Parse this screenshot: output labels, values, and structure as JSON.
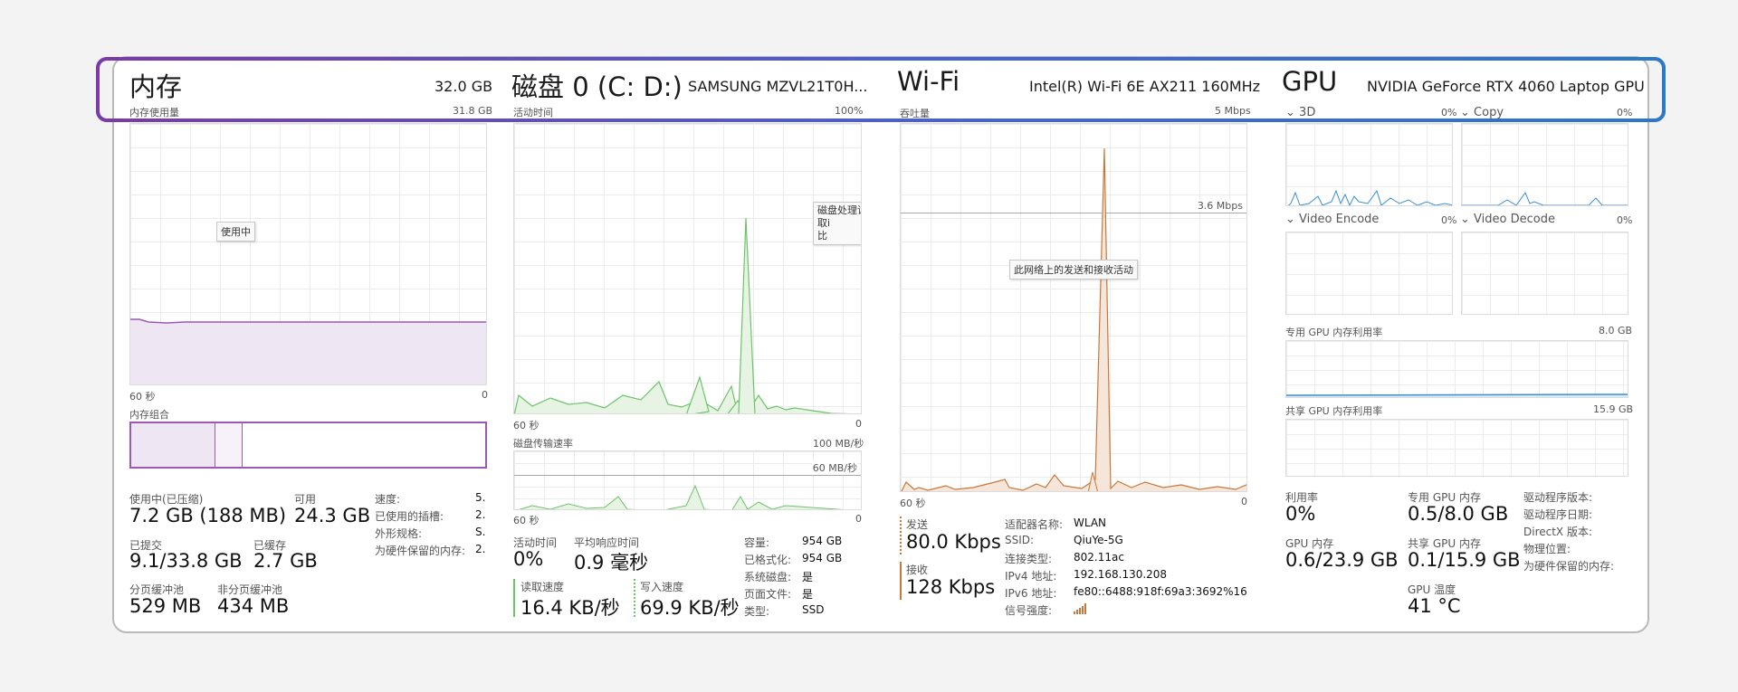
{
  "memory": {
    "title": "内存",
    "total": "32.0 GB",
    "usage_label": "内存使用量",
    "usage_max": "31.8 GB",
    "tooltip": "使用中",
    "axis_left": "60 秒",
    "axis_right": "0",
    "composition_label": "内存组合",
    "in_use_label": "使用中(已压缩)",
    "in_use_value": "7.2 GB (188 MB)",
    "available_label": "可用",
    "available_value": "24.3 GB",
    "committed_label": "已提交",
    "committed_value": "9.1/33.8 GB",
    "cached_label": "已缓存",
    "cached_value": "2.7 GB",
    "paged_label": "分页缓冲池",
    "paged_value": "529 MB",
    "nonpaged_label": "非分页缓冲池",
    "nonpaged_value": "434 MB",
    "speed_label": "速度:",
    "speed_value": "5.",
    "slots_label": "已使用的插槽:",
    "slots_value": "2.",
    "form_label": "外形规格:",
    "form_value": "S.",
    "reserved_label": "为硬件保留的内存:",
    "reserved_value": "2."
  },
  "disk": {
    "title": "磁盘 0 (C: D:)",
    "model": "SAMSUNG MZVL21T0H...",
    "active_label": "活动时间",
    "active_max": "100%",
    "tooltip": "磁盘处理读取i\n比",
    "axis_left": "60 秒",
    "axis_right": "0",
    "transfer_label": "磁盘传输速率",
    "transfer_max": "100 MB/秒",
    "transfer_mark": "60 MB/秒",
    "axis2_left": "60 秒",
    "axis2_right": "0",
    "active_time_label": "活动时间",
    "active_time_value": "0%",
    "response_label": "平均响应时间",
    "response_value": "0.9 毫秒",
    "read_label": "读取速度",
    "read_value": "16.4 KB/秒",
    "write_label": "写入速度",
    "write_value": "69.9 KB/秒",
    "capacity_label": "容量:",
    "capacity_value": "954 GB",
    "formatted_label": "已格式化:",
    "formatted_value": "954 GB",
    "system_label": "系统磁盘:",
    "system_value": "是",
    "pagefile_label": "页面文件:",
    "pagefile_value": "是",
    "type_label": "类型:",
    "type_value": "SSD"
  },
  "wifi": {
    "title": "Wi-Fi",
    "adapter": "Intel(R) Wi-Fi 6E AX211 160MHz",
    "throughput_label": "吞吐量",
    "throughput_max": "5 Mbps",
    "mark": "3.6 Mbps",
    "tooltip": "此网络上的发送和接收活动",
    "axis_left": "60 秒",
    "axis_right": "0",
    "send_label": "发送",
    "send_value": "80.0 Kbps",
    "recv_label": "接收",
    "recv_value": "128 Kbps",
    "adapter_name_label": "适配器名称:",
    "adapter_name_value": "WLAN",
    "ssid_label": "SSID:",
    "ssid_value": "QiuYe-5G",
    "conn_label": "连接类型:",
    "conn_value": "802.11ac",
    "ipv4_label": "IPv4 地址:",
    "ipv4_value": "192.168.130.208",
    "ipv6_label": "IPv6 地址:",
    "ipv6_value": "fe80::6488:918f:69a3:3692%16",
    "signal_label": "信号强度:"
  },
  "gpu": {
    "title": "GPU",
    "model": "NVIDIA GeForce RTX 4060 Laptop GPU",
    "eng1": "3D",
    "eng1_pct": "0%",
    "eng2": "Copy",
    "eng2_pct": "0%",
    "eng3": "Video Encode",
    "eng3_pct": "0%",
    "eng4": "Video Decode",
    "eng4_pct": "0%",
    "dedicated_label": "专用 GPU 内存利用率",
    "dedicated_max": "8.0 GB",
    "shared_label": "共享 GPU 内存利用率",
    "shared_max": "15.9 GB",
    "util_label": "利用率",
    "util_value": "0%",
    "ded_mem_label": "专用 GPU 内存",
    "ded_mem_value": "0.5/8.0 GB",
    "gpu_mem_label": "GPU 内存",
    "gpu_mem_value": "0.6/23.9 GB",
    "shared_mem_label": "共享 GPU 内存",
    "shared_mem_value": "0.1/15.9 GB",
    "temp_label": "GPU 温度",
    "temp_value": "41 °C",
    "driver_ver_label": "驱动程序版本:",
    "driver_date_label": "驱动程序日期:",
    "directx_label": "DirectX 版本:",
    "location_label": "物理位置:",
    "reserved_label": "为硬件保留的内存:"
  },
  "colors": {
    "memory": "#9b59b6",
    "disk": "#4caf50",
    "wifi": "#c8773a",
    "gpu": "#3a8fd6"
  }
}
